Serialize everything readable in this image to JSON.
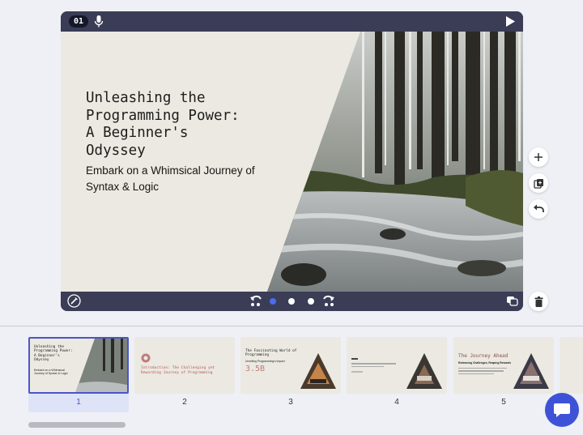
{
  "editor": {
    "slide_number": "01",
    "slide": {
      "title": "Unleashing the\nProgramming Power:\nA Beginner's\nOdyssey",
      "subtitle": "Embark on a Whimsical Journey of Syntax & Logic"
    }
  },
  "thumbnails": [
    {
      "label": "1",
      "title": "Unleashing the Programming Power: A Beginner's Odyssey",
      "subtitle": "Embark on a Whimsical Journey of Syntax & Logic",
      "active": true
    },
    {
      "label": "2",
      "title": "Introduction: The Challenging yet Rewarding Journey of Programming"
    },
    {
      "label": "3",
      "title": "The Fascinating World of Programming",
      "subtitle": "Unveiling Programming's Impact",
      "stat": "3.5B"
    },
    {
      "label": "4",
      "title": ""
    },
    {
      "label": "5",
      "title": "The Journey Ahead",
      "subtitle": "Embracing Challenges, Reaping Rewards"
    }
  ],
  "colors": {
    "accent": "#3e52d8",
    "bar": "#3a3d55",
    "slide_bg": "#ebe9e1"
  }
}
